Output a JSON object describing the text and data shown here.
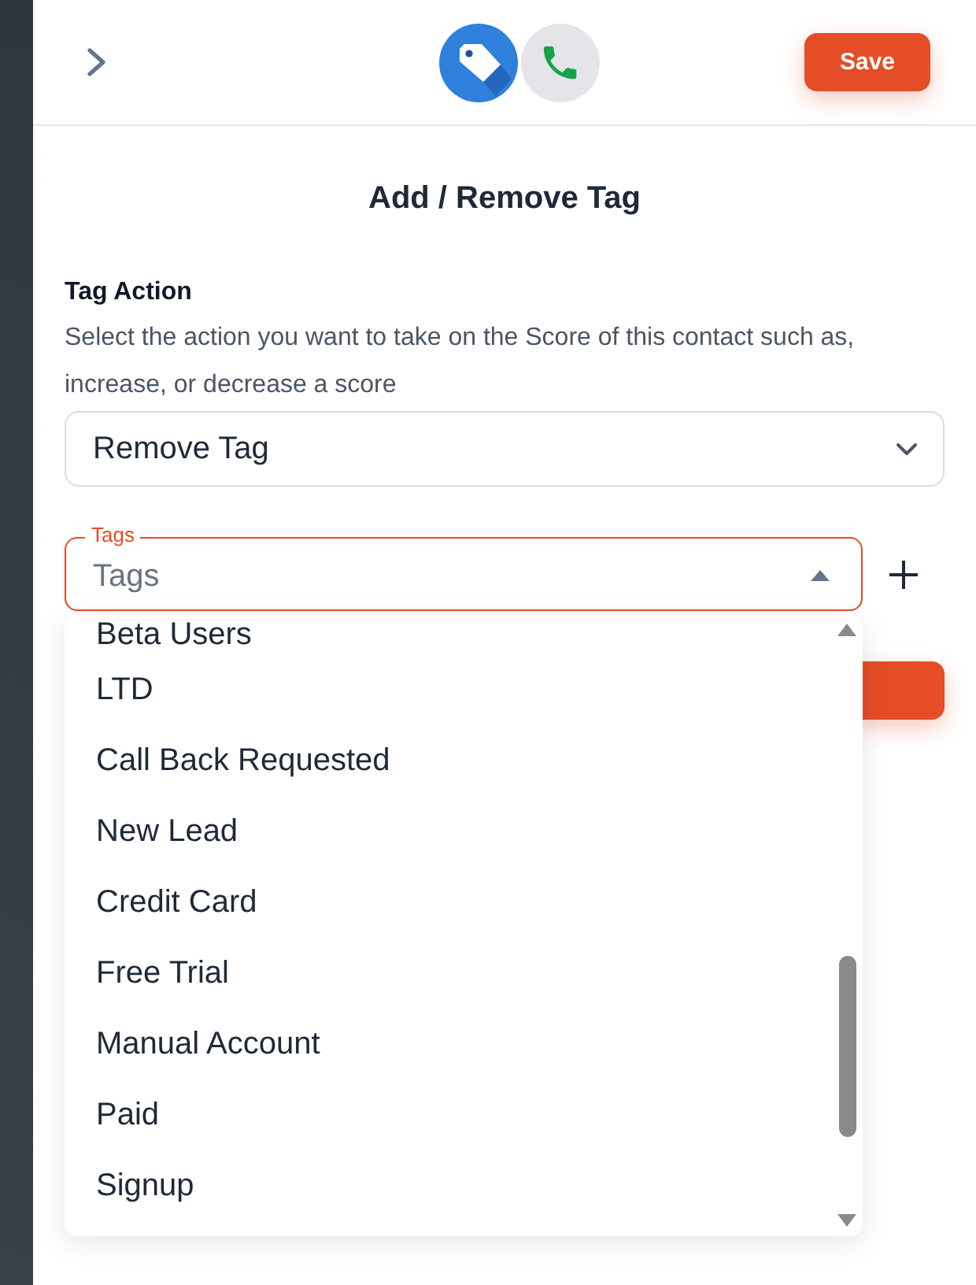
{
  "header": {
    "save_button": "Save"
  },
  "title": "Add / Remove Tag",
  "tag_action": {
    "label": "Tag Action",
    "description": "Select the action you want to take on the Score of this contact such as, increase, or decrease a score",
    "value": "Remove Tag"
  },
  "tags_field": {
    "label": "Tags",
    "placeholder": "Tags",
    "expanded": true
  },
  "tag_options": [
    {
      "label": "Beta Users",
      "selected": false
    },
    {
      "label": "LTD",
      "selected": false
    },
    {
      "label": "Call Back Requested",
      "selected": false
    },
    {
      "label": "New Lead",
      "selected": false
    },
    {
      "label": "Credit Card",
      "selected": false
    },
    {
      "label": "Free Trial",
      "selected": false
    },
    {
      "label": "Manual Account",
      "selected": false
    },
    {
      "label": "Paid",
      "selected": false
    },
    {
      "label": "Signup",
      "selected": false
    }
  ]
}
